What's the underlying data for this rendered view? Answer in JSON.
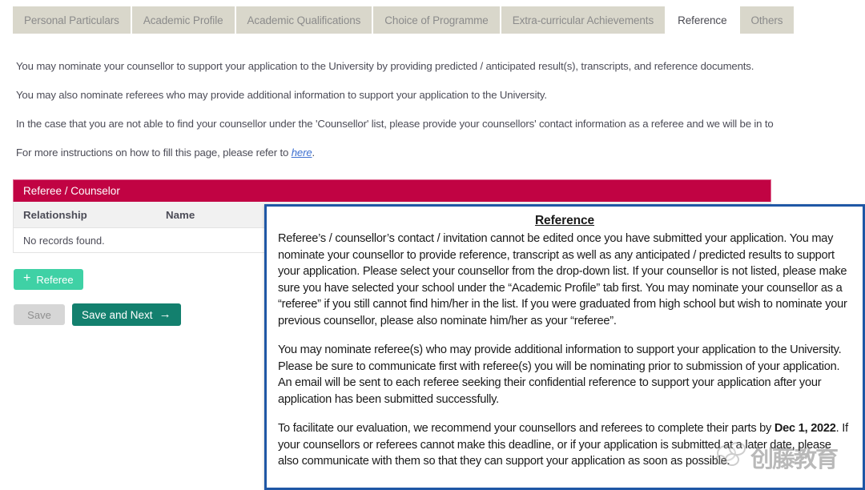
{
  "tabs": [
    {
      "label": "Personal Particulars",
      "active": false
    },
    {
      "label": "Academic Profile",
      "active": false
    },
    {
      "label": "Academic Qualifications",
      "active": false
    },
    {
      "label": "Choice of Programme",
      "active": false
    },
    {
      "label": "Extra-curricular Achievements",
      "active": false
    },
    {
      "label": "Reference",
      "active": true
    },
    {
      "label": "Others",
      "active": false
    }
  ],
  "intro": {
    "p1": "You may nominate your counsellor to support your application to the University by providing predicted / anticipated result(s), transcripts, and reference documents.",
    "p2": "You may also nominate referees who may provide additional information to support your application to the University.",
    "p3": "In the case that you are not able to find your counsellor under the 'Counsellor' list, please provide your counsellors' contact information as a referee and we will be in to",
    "p4_before": "For more instructions on how to fill this page, please refer to ",
    "p4_link": "here",
    "p4_after": "."
  },
  "panel": {
    "title": "Referee / Counselor",
    "columns": [
      "Relationship",
      "Name",
      "",
      ""
    ],
    "empty_message": "No records found."
  },
  "buttons": {
    "add_referee": "Referee",
    "add_referee_icon": "plus-icon",
    "save": "Save",
    "save_and_next": "Save and Next",
    "save_and_next_icon": "arrow-right-icon"
  },
  "overlay": {
    "title": "Reference",
    "paragraph1": "Referee’s / counsellor’s contact / invitation cannot be edited once you have submitted your application. You may nominate your counsellor to provide reference, transcript as well as any anticipated / predicted results to support your application. Please select your counsellor from the drop-down list. If your counsellor is not listed, please make sure you have selected your school under the “Academic Profile” tab first. You may nominate your counsellor as a “referee” if you still cannot find him/her in the list. If you were graduated from high school but wish to nominate your previous counsellor, please also nominate him/her as your “referee”.",
    "paragraph2": "You may nominate referee(s) who may provide additional information to support your application to the University. Please be sure to communicate first with referee(s) you will be nominating prior to submission of your application.  An email will be sent to each referee seeking their confidential reference to support your application after your application has been submitted successfully.",
    "paragraph3_part1": "To facilitate our evaluation, we recommend your counsellors and referees to complete their parts by ",
    "paragraph3_bold": "Dec 1, 2022",
    "paragraph3_part2": ". If your counsellors or referees cannot make this deadline, or if your application is submitted at a later date, please also communicate with them so that they can support your application as soon as possible."
  },
  "watermark": {
    "text": "创藤教育"
  },
  "colors": {
    "panel_header": "#c10343",
    "tab_inactive": "#d9d7cb",
    "add_button": "#3fd1a5",
    "save_next_button": "#13806e",
    "overlay_border": "#1f57a5",
    "link": "#3c6fd0"
  }
}
